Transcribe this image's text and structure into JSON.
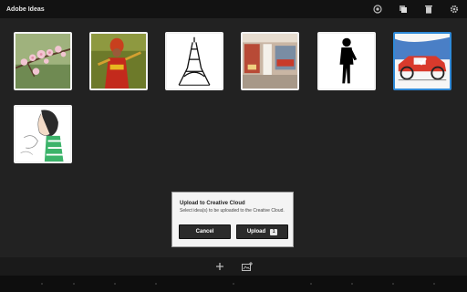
{
  "app": {
    "title": "Adobe Ideas"
  },
  "toolbar": {
    "icons": [
      "cloud-sync-icon",
      "duplicate-icon",
      "trash-icon",
      "settings-icon"
    ]
  },
  "gallery": {
    "items": [
      {
        "name": "cherry-blossom",
        "selected": false
      },
      {
        "name": "costume-figure",
        "selected": false
      },
      {
        "name": "eiffel-tower",
        "selected": false
      },
      {
        "name": "store-interior",
        "selected": false
      },
      {
        "name": "silhouette-man",
        "selected": false
      },
      {
        "name": "red-car-sketch",
        "selected": true
      },
      {
        "name": "girl-illustration",
        "selected": false
      }
    ]
  },
  "dialog": {
    "title": "Upload to Creative Cloud",
    "message": "Select idea(s) to be uploaded to the Creative Cloud.",
    "cancel_label": "Cancel",
    "upload_label": "Upload",
    "upload_count": "1"
  },
  "bottom": {
    "icons": [
      "add-icon",
      "add-photo-icon"
    ]
  },
  "colors": {
    "selection": "#2f8ad8",
    "background": "#222222",
    "topbar": "#121212"
  }
}
